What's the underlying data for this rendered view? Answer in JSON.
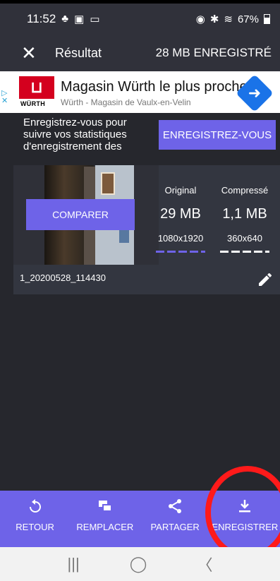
{
  "status": {
    "time": "11:52",
    "battery": "67%"
  },
  "appbar": {
    "title": "Résultat",
    "size_label": "28 MB ENREGISTRÉ"
  },
  "ad": {
    "headline": "Magasin Würth le plus proche",
    "subline": "Würth - Magasin de Vaulx-en-Velin",
    "brand": "WÜRTH"
  },
  "promo": {
    "text": "Enregistrez-vous pour suivre vos statistiques d'enregistrement des",
    "button": "ENREGISTREZ-VOUS"
  },
  "result": {
    "compare_button": "COMPARER",
    "original": {
      "label": "Original",
      "size": "29 MB",
      "resolution": "1080x1920"
    },
    "compressed": {
      "label": "Compressé",
      "size": "1,1 MB",
      "resolution": "360x640"
    },
    "filename": "1_20200528_114430"
  },
  "bottom_bar": {
    "items": [
      {
        "label": "RETOUR",
        "icon": "undo-icon"
      },
      {
        "label": "REMPLACER",
        "icon": "replace-icon"
      },
      {
        "label": "PARTAGER",
        "icon": "share-icon"
      },
      {
        "label": "ENREGISTRER",
        "icon": "download-icon"
      }
    ]
  },
  "colors": {
    "accent": "#6e63e8",
    "background": "#26272d",
    "highlight_circle": "#ff1a1a"
  }
}
